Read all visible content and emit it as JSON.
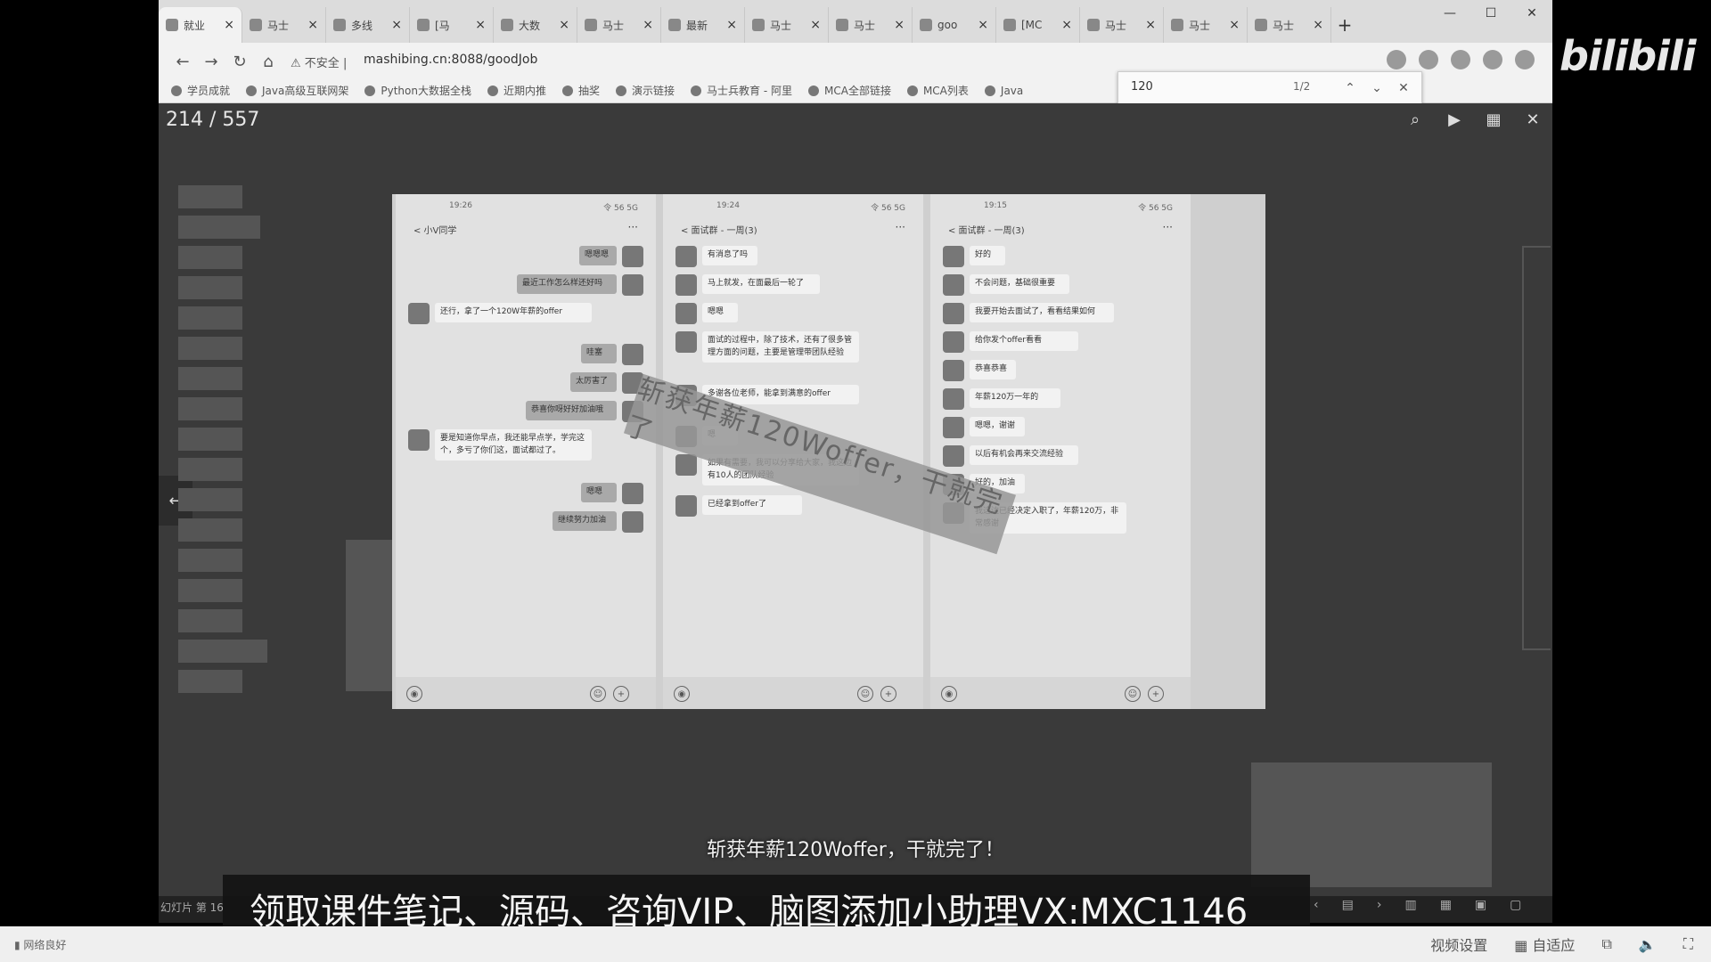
{
  "browser": {
    "tabs": [
      {
        "title": "就业",
        "active": true
      },
      {
        "title": "马士",
        "active": false
      },
      {
        "title": "多线",
        "active": false
      },
      {
        "title": "[马",
        "active": false
      },
      {
        "title": "大数",
        "active": false
      },
      {
        "title": "马士",
        "active": false
      },
      {
        "title": "最新",
        "active": false
      },
      {
        "title": "马士",
        "active": false
      },
      {
        "title": "马士",
        "active": false
      },
      {
        "title": "goo",
        "active": false
      },
      {
        "title": "[MC",
        "active": false
      },
      {
        "title": "马士",
        "active": false
      },
      {
        "title": "马士",
        "active": false
      },
      {
        "title": "马士",
        "active": false
      }
    ],
    "new_tab": "+",
    "security_label": "不安全",
    "url": "mashibing.cn:8088/goodJob",
    "bookmarks": [
      "学员成就",
      "Java高级互联网架",
      "Python大数据全栈",
      "近期内推",
      "抽奖",
      "演示链接",
      "马士兵教育 - 阿里",
      "MCA全部链接",
      "MCA列表",
      "Java"
    ],
    "find": {
      "query": "120",
      "count": "1/2"
    }
  },
  "viewer": {
    "page_counter": "214 / 557",
    "stamp_text": "斩获年薪120Woffer，干就完了"
  },
  "slide": {
    "phones": [
      {
        "time": "19:26",
        "title": "< 小V同学",
        "status": "令 56 5G",
        "messages": [
          {
            "side": "me",
            "text": "嗯嗯嗯"
          },
          {
            "side": "me",
            "text": "最近工作怎么样还好吗"
          },
          {
            "side": "other",
            "text": "还行，拿了一个120W年薪的offer"
          },
          {
            "side": "me",
            "text": "哇塞"
          },
          {
            "side": "me",
            "text": "太厉害了"
          },
          {
            "side": "me",
            "text": "恭喜你呀好好加油哦"
          },
          {
            "side": "other",
            "text": "要是知道你早点，我还能早点学，学完这个，多亏了你们这，面试都过了。"
          },
          {
            "side": "me",
            "text": "嗯嗯"
          },
          {
            "side": "me",
            "text": "继续努力加油"
          }
        ]
      },
      {
        "time": "19:24",
        "title": "< 面试群 - 一周(3)",
        "status": "令 56 5G",
        "messages": [
          {
            "side": "other",
            "text": "有消息了吗"
          },
          {
            "side": "other",
            "text": "马上就发，在面最后一轮了"
          },
          {
            "side": "other",
            "text": "嗯嗯"
          },
          {
            "side": "other",
            "text": "面试的过程中，除了技术，还有了很多管理方面的问题，主要是管理带团队经验"
          },
          {
            "side": "other",
            "text": "多谢各位老师，能拿到满意的offer"
          },
          {
            "side": "other",
            "text": "嗯"
          },
          {
            "side": "other",
            "text": "如果有需要，我可以分享给大家，我这边有10人的团队经验"
          },
          {
            "side": "other",
            "text": "已经拿到offer了"
          }
        ]
      },
      {
        "time": "19:15",
        "title": "< 面试群 - 一周(3)",
        "status": "令 56 5G",
        "messages": [
          {
            "side": "other",
            "text": "好的"
          },
          {
            "side": "other",
            "text": "不会问题，基础很重要"
          },
          {
            "side": "other",
            "text": "我要开始去面试了，看看结果如何"
          },
          {
            "side": "other",
            "text": "给你发个offer看看"
          },
          {
            "side": "other",
            "text": "恭喜恭喜"
          },
          {
            "side": "other",
            "text": "年薪120万一年的"
          },
          {
            "side": "other",
            "text": "嗯嗯，谢谢"
          },
          {
            "side": "other",
            "text": "以后有机会再来交流经验"
          },
          {
            "side": "other",
            "text": "好的，加油"
          },
          {
            "side": "other",
            "text": "我这边已经决定入职了，年薪120万，非常感谢"
          }
        ]
      }
    ]
  },
  "subtitle": "斩获年薪120Woffer，干就完了！",
  "banner": "领取课件笔记、源码、咨询VIP、脑图添加小助理VX:MXC1146",
  "player": {
    "left_label": "网络良好",
    "video_settings": "视频设置",
    "fit": "自适应",
    "logo": "bilibili",
    "slides_label": "幻灯片 第 16"
  }
}
